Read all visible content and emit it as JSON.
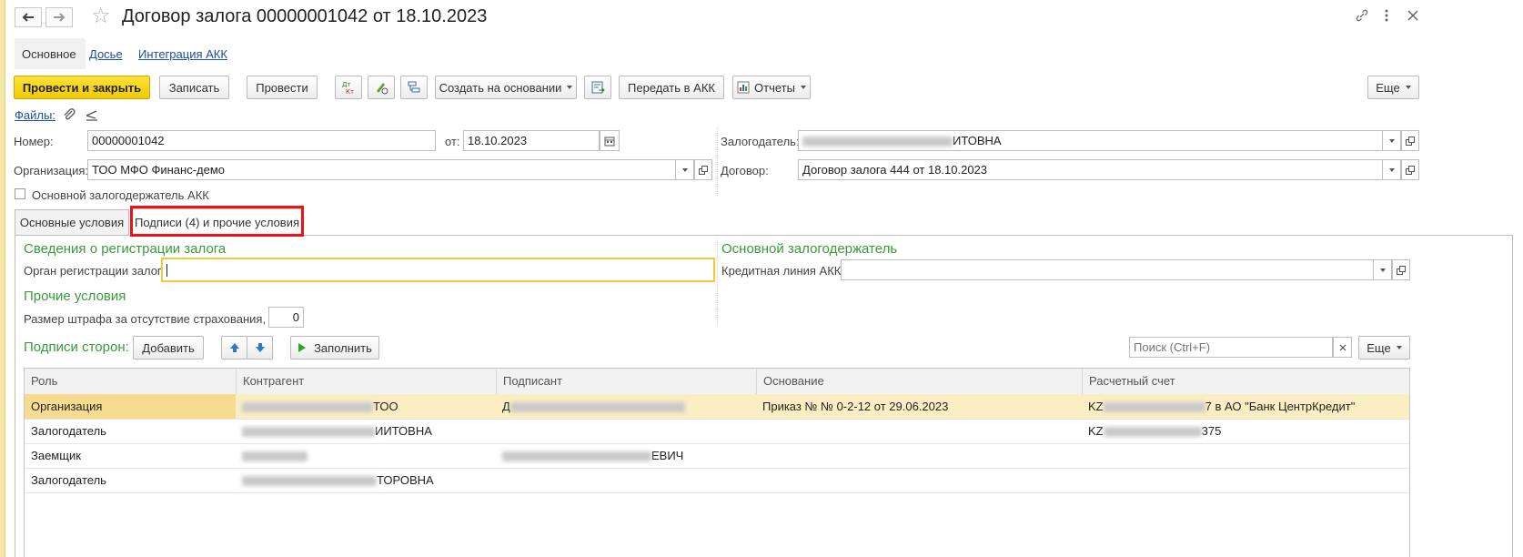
{
  "window": {
    "title": "Договор залога 00000001042 от 18.10.2023",
    "icons": [
      "back-arrow",
      "forward-arrow",
      "star",
      "link",
      "more-vertical",
      "close"
    ]
  },
  "sections": [
    {
      "label": "Основное"
    },
    {
      "label": "Досье"
    },
    {
      "label": "Интеграция АКК"
    }
  ],
  "toolbar": {
    "post_close": "Провести и закрыть",
    "save": "Записать",
    "post": "Провести",
    "create_based": "Создать на основании",
    "send_akk": "Передать в АКК",
    "reports": "Отчеты",
    "more": "Еще"
  },
  "files": {
    "label": "Файлы:"
  },
  "form": {
    "number_label": "Номер:",
    "number_value": "00000001042",
    "date_label": "от:",
    "date_value": "18.10.2023",
    "org_label": "Организация:",
    "org_value": "ТОО МФО Финанс-демо",
    "pledger_label": "Залогодатель:",
    "pledger_value_visible": "ИТОВНА",
    "contract_label": "Договор:",
    "contract_value": "Договор залога 444 от 18.10.2023",
    "main_holder_checkbox": "Основной залогодержатель АКК"
  },
  "tabs": [
    {
      "label": "Основные условия",
      "active": false
    },
    {
      "label": "Подписи (4) и прочие условия",
      "active": true
    }
  ],
  "panel": {
    "registration_header": "Сведения о регистрации залога",
    "registration_label": "Орган регистрации залога:",
    "registration_value": "",
    "main_holder_header": "Основной залогодержатель",
    "credit_line_label": "Кредитная линия АКК:",
    "credit_line_value": "",
    "other_header": "Прочие условия",
    "penalty_label": "Размер штрафа за отсутствие страхования, %:",
    "penalty_value": "0",
    "signatures_label": "Подписи сторон:",
    "add_button": "Добавить",
    "fill_button": "Заполнить",
    "search_placeholder": "Поиск (Ctrl+F)",
    "more_button": "Еще"
  },
  "table": {
    "columns": [
      "Роль",
      "Контрагент",
      "Подписант",
      "Основание",
      "Расчетный счет"
    ],
    "rows": [
      {
        "role": "Организация",
        "counterparty": "ТОО",
        "signer": "Д",
        "basis": "Приказ №  № 0-2-12 от 29.06.2023",
        "account_start": "KZ",
        "account_end": "7 в АО \"Банк ЦентрКредит\"",
        "selected": true
      },
      {
        "role": "Залогодатель",
        "counterparty": "ИИТОВНА",
        "signer": "",
        "basis": "",
        "account_start": "KZ",
        "account_end": "375",
        "selected": false
      },
      {
        "role": "Заемщик",
        "counterparty": "",
        "signer": "ЕВИЧ",
        "basis": "",
        "account_start": "",
        "account_end": "",
        "selected": false
      },
      {
        "role": "Залогодатель",
        "counterparty": "ТОРОВНА",
        "signer": "",
        "basis": "",
        "account_start": "",
        "account_end": "",
        "selected": false
      }
    ]
  },
  "colors": {
    "primary_button": "#f4cd0f",
    "highlight_box": "#e8141a",
    "section_header": "#3a9b3a",
    "selected_row": "#fbeec2"
  }
}
